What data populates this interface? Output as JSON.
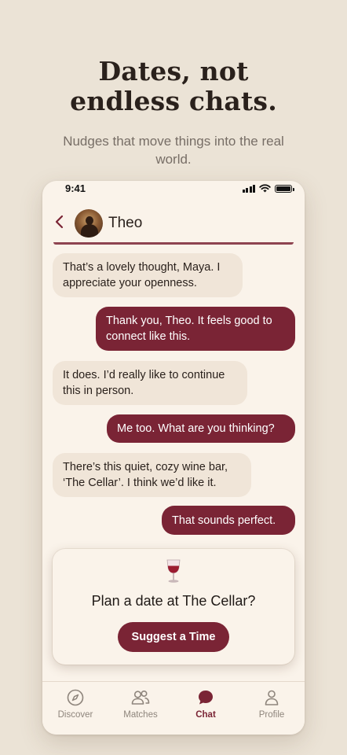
{
  "hero": {
    "title_line1": "Dates, not",
    "title_line2": "endless chats.",
    "subtitle": "Nudges that move things into the real world."
  },
  "status_bar": {
    "time": "9:41"
  },
  "chat": {
    "contact_name": "Theo",
    "messages": [
      {
        "from": "them",
        "text": "That’s a lovely thought, Maya. I appreciate your openness."
      },
      {
        "from": "me",
        "text": "Thank you, Theo. It feels good to connect like this."
      },
      {
        "from": "them",
        "text": "It does. I’d really like to continue this in person."
      },
      {
        "from": "me",
        "text": "Me too. What are you thinking?"
      },
      {
        "from": "them",
        "text": "There’s this quiet, cozy wine bar, ‘The Cellar’. I think we’d like it."
      },
      {
        "from": "me",
        "text": "That sounds perfect."
      }
    ]
  },
  "plan_card": {
    "icon": "wine-glass-icon",
    "title": "Plan a date at The Cellar?",
    "button_label": "Suggest a Time"
  },
  "tabbar": {
    "active": "Chat",
    "tabs": [
      {
        "label": "Discover",
        "icon": "compass-icon"
      },
      {
        "label": "Matches",
        "icon": "people-icon"
      },
      {
        "label": "Chat",
        "icon": "chat-bubble-icon"
      },
      {
        "label": "Profile",
        "icon": "person-icon"
      }
    ]
  },
  "colors": {
    "accent": "#7a2435",
    "background": "#ebe3d6",
    "screen": "#faf3ea",
    "incoming_bubble": "#f0e5d8"
  }
}
